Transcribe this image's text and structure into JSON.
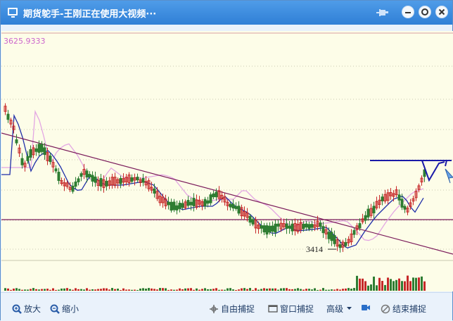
{
  "window": {
    "title": "期货鸵手-王刚正在使用大视频···",
    "icons": {
      "app": "monitor-icon",
      "pin": "pin-icon",
      "minimize": "minimize-icon",
      "maximize": "maximize-icon",
      "close": "close-icon"
    }
  },
  "chart": {
    "price_label": "3625.9333",
    "low_label": "3414"
  },
  "toolbar": {
    "zoom_in": "放大",
    "zoom_out": "缩小",
    "free_capture": "自由捕捉",
    "window_capture": "窗口捕捉",
    "advanced": "高级",
    "end_capture": "结束捕捉"
  },
  "colors": {
    "titlebar": "#2f7fd6",
    "chart_bg": "#fdfde8",
    "up": "#c62828",
    "down": "#2e7d32",
    "ma_blue": "#1f2ea8",
    "ma_pink": "#e3a6e3",
    "line_purple": "#7a1a5a"
  }
}
